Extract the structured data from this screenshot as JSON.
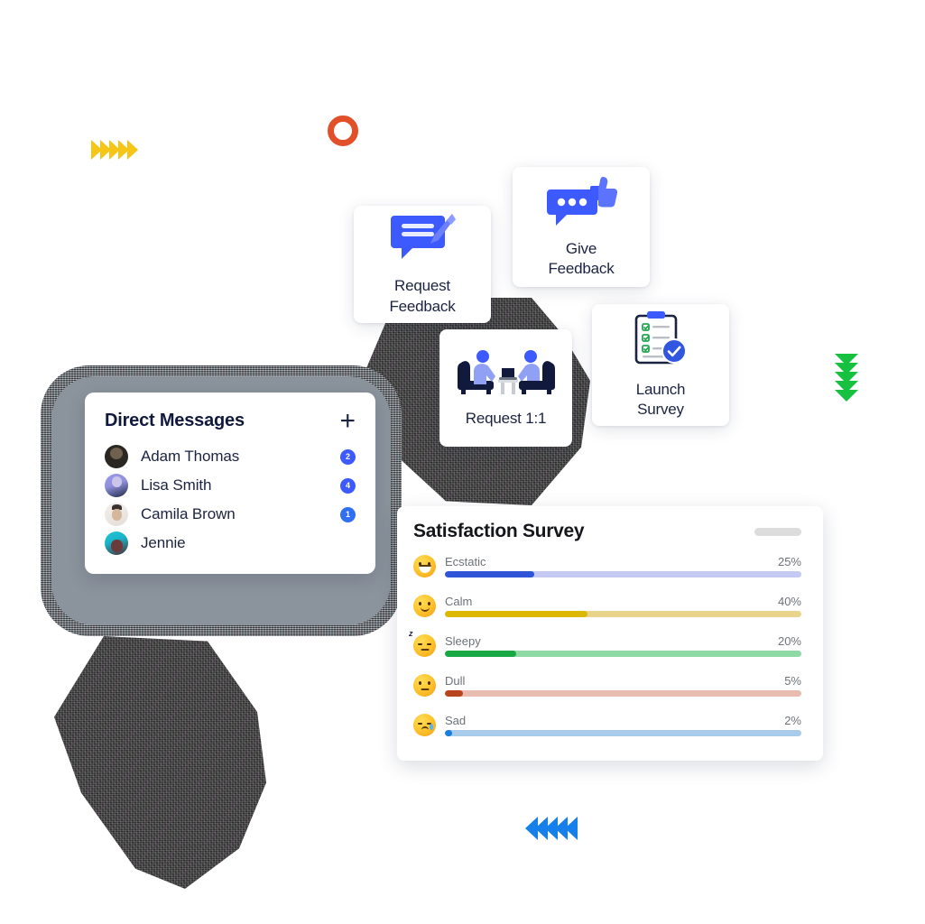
{
  "decor": {
    "yellow_chevrons": {
      "name": "yellow-chevrons-right",
      "count": 5,
      "color": "#f5c518",
      "direction": "right"
    },
    "orange_ring": {
      "name": "orange-ring",
      "color": "#e2502a"
    },
    "green_chevrons": {
      "name": "green-chevrons-down",
      "count": 5,
      "color": "#17c140",
      "direction": "down"
    },
    "blue_chevrons": {
      "name": "blue-chevrons-left",
      "count": 5,
      "color": "#1580ea",
      "direction": "left"
    }
  },
  "direct_messages": {
    "title": "Direct Messages",
    "add_icon": "+",
    "badge_color": "#3d5afe",
    "contacts": [
      {
        "name": "Adam Thomas",
        "badge": "2",
        "avatar": "avatar-adam-thomas"
      },
      {
        "name": "Lisa Smith",
        "badge": "4",
        "avatar": "avatar-lisa-smith"
      },
      {
        "name": "Camila Brown",
        "badge": "1",
        "avatar": "avatar-camila-brown"
      },
      {
        "name": "Jennie",
        "badge": "",
        "avatar": "avatar-jennie"
      }
    ]
  },
  "action_cards": [
    {
      "id": "request-feedback",
      "label": "Request\nFeedback",
      "line1": "Request",
      "line2": "Feedback",
      "icon": "chat-bubble-pencil-icon",
      "accent": "#3d5afe"
    },
    {
      "id": "give-feedback",
      "label": "Give\nFeedback",
      "line1": "Give",
      "line2": "Feedback",
      "icon": "chat-bubble-thumbs-up-icon",
      "accent": "#3d5afe"
    },
    {
      "id": "request-1-1",
      "label": "Request 1:1",
      "line1": "Request 1:1",
      "line2": "",
      "icon": "two-people-meeting-icon",
      "accent": "#3d5afe"
    },
    {
      "id": "launch-survey",
      "label": "Launch\nSurvey",
      "line1": "Launch",
      "line2": "Survey",
      "icon": "clipboard-checklist-icon",
      "accent": "#3d5afe"
    }
  ],
  "survey": {
    "title": "Satisfaction Survey",
    "menu_placeholder": "menu-placeholder-pill"
  },
  "chart_data": {
    "type": "bar",
    "title": "Satisfaction Survey",
    "xlabel": "",
    "ylabel": "",
    "orientation": "horizontal",
    "categories": [
      "Ecstatic",
      "Calm",
      "Sleepy",
      "Dull",
      "Sad"
    ],
    "values": [
      25,
      40,
      20,
      5,
      2
    ],
    "value_labels": [
      "25%",
      "40%",
      "20%",
      "5%",
      "2%"
    ],
    "xlim": [
      0,
      100
    ],
    "grid": false,
    "legend": false,
    "series": [
      {
        "name": "Ecstatic",
        "value": 25,
        "label": "25%",
        "emoji": "grinning-face-emoji",
        "fill_color": "#2f54d8",
        "track_color": "#c3c9f0"
      },
      {
        "name": "Calm",
        "value": 40,
        "label": "40%",
        "emoji": "smiling-face-emoji",
        "fill_color": "#ddb800",
        "track_color": "#e8d48c"
      },
      {
        "name": "Sleepy",
        "value": 20,
        "label": "20%",
        "emoji": "sleepy-face-emoji",
        "fill_color": "#1aa845",
        "track_color": "#8ed9a4"
      },
      {
        "name": "Dull",
        "value": 5,
        "label": "5%",
        "emoji": "neutral-face-emoji",
        "fill_color": "#b8451f",
        "track_color": "#e8bcae"
      },
      {
        "name": "Sad",
        "value": 2,
        "label": "2%",
        "emoji": "crying-face-emoji",
        "fill_color": "#1a7de0",
        "track_color": "#a8cbea"
      }
    ]
  }
}
